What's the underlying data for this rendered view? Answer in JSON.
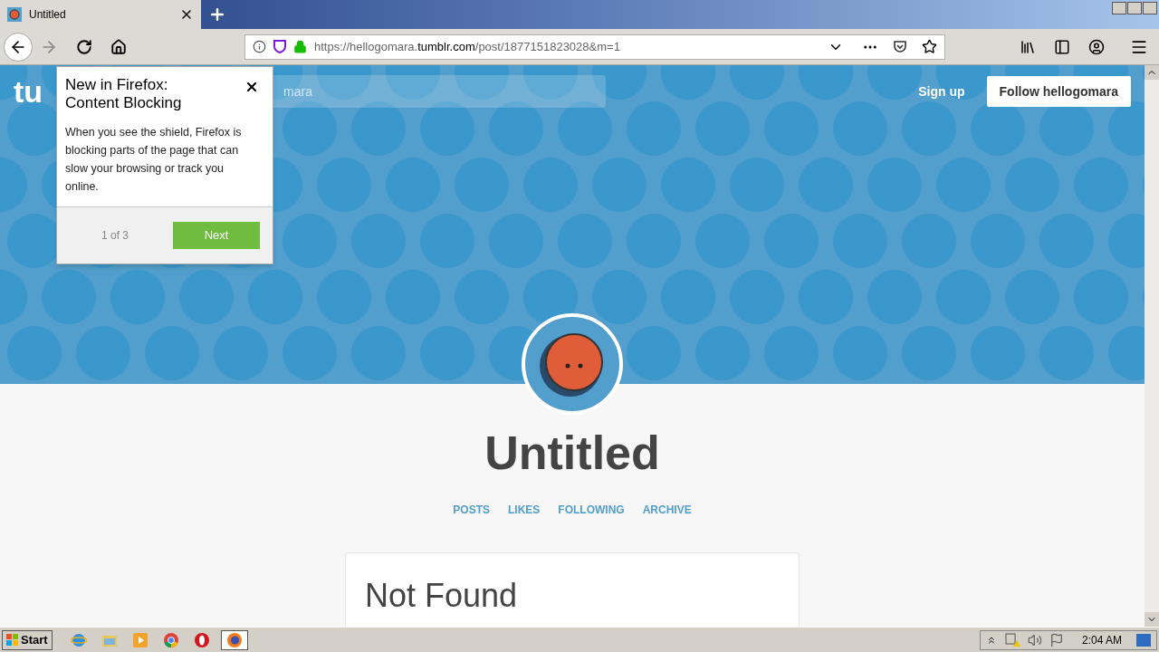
{
  "tabs": [
    {
      "title": "Untitled",
      "selected": true
    }
  ],
  "url": {
    "start": "https://hellogomara.",
    "domain": "tumblr.com",
    "end": "/post/1877151823028&m=1"
  },
  "site": {
    "logo": "tu",
    "search_placeholder": "mara",
    "sign_up": "Sign up",
    "follow": "Follow hellogomara",
    "title": "Untitled",
    "nav": [
      "POSTS",
      "LIKES",
      "FOLLOWING",
      "ARCHIVE"
    ],
    "card_title": "Not Found"
  },
  "popup": {
    "title": "New in Firefox: Content Blocking",
    "body": "When you see the shield, Firefox is blocking parts of the page that can slow your browsing or track you online.",
    "step": "1 of 3",
    "next": "Next"
  },
  "taskbar": {
    "start": "Start",
    "apps": [
      {
        "kind": "ie",
        "selected": false
      },
      {
        "kind": "folder",
        "selected": false
      },
      {
        "kind": "media",
        "selected": false
      },
      {
        "kind": "chrome",
        "selected": false
      },
      {
        "kind": "opera",
        "selected": false
      },
      {
        "kind": "firefox",
        "selected": true
      }
    ],
    "time": "2:04 AM"
  }
}
